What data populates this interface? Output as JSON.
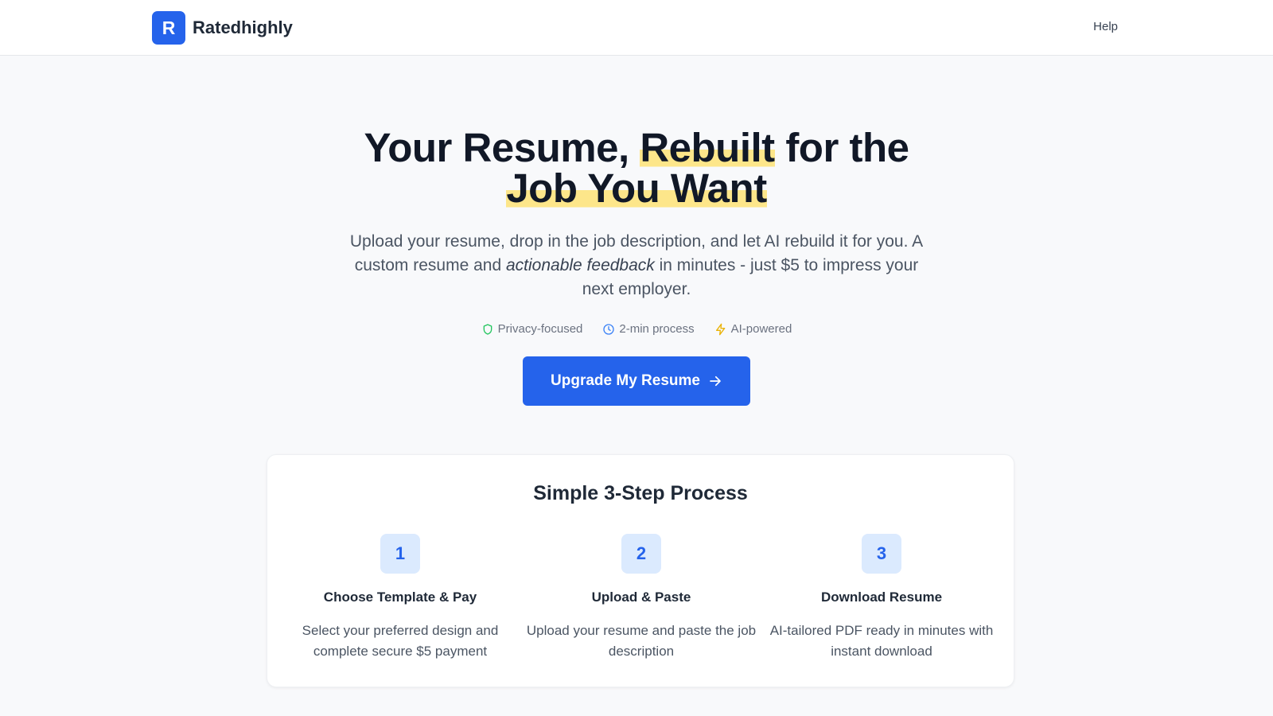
{
  "header": {
    "brand_letter": "R",
    "brand_name": "Ratedhighly",
    "help_label": "Help"
  },
  "hero": {
    "headline_part1": "Your Resume, ",
    "headline_highlight1": "Rebuilt",
    "headline_part2": " for the",
    "headline_highlight2": "Job You Want",
    "subtitle_part1": "Upload your resume, drop in the job description, and let AI rebuild it for you. A custom resume and ",
    "subtitle_emphasis": "actionable feedback",
    "subtitle_part2": " in minutes - just $5 to impress your next employer.",
    "badges": [
      {
        "icon": "shield-icon",
        "label": "Privacy-focused",
        "color": "#22c55e"
      },
      {
        "icon": "clock-icon",
        "label": "2-min process",
        "color": "#3b82f6"
      },
      {
        "icon": "lightning-icon",
        "label": "AI-powered",
        "color": "#eab308"
      }
    ],
    "cta_label": "Upgrade My Resume"
  },
  "process": {
    "title": "Simple 3-Step Process",
    "steps": [
      {
        "number": "1",
        "title": "Choose Template & Pay",
        "description": "Select your preferred design and complete secure $5 payment"
      },
      {
        "number": "2",
        "title": "Upload & Paste",
        "description": "Upload your resume and paste the job description"
      },
      {
        "number": "3",
        "title": "Download Resume",
        "description": "AI-tailored PDF ready in minutes with instant download"
      }
    ]
  },
  "colors": {
    "accent": "#2563eb",
    "highlight": "#fde68a",
    "background": "#f8f9fb"
  }
}
